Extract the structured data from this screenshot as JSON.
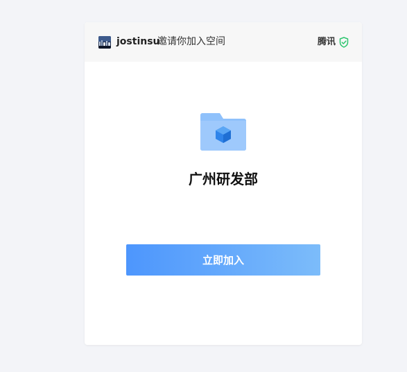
{
  "header": {
    "inviter_name": "jostinsu",
    "invite_text": "邀请你加入空间",
    "org_name": "腾讯",
    "verified_icon": "shield-check-icon",
    "avatar": "user-avatar"
  },
  "main": {
    "folder_icon": "folder-cube-icon",
    "space_name": "广州研发部",
    "join_label": "立即加入"
  },
  "colors": {
    "background": "#f3f4f8",
    "header_background": "#f7f7f7",
    "verified_green": "#2dc56e",
    "button_gradient_start": "#4d96fd",
    "button_gradient_end": "#7cbcfa",
    "folder_blue": "#8fc1fb"
  }
}
